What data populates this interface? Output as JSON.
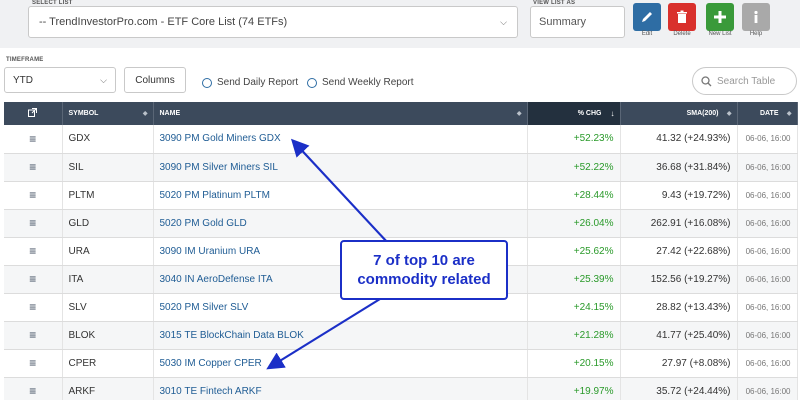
{
  "header": {
    "select_list_label": "SELECT LIST",
    "select_list_value": "-- TrendInvestorPro.com - ETF Core List (74 ETFs)",
    "view_list_as_label": "VIEW LIST AS",
    "view_list_as_value": "Summary",
    "tools": [
      {
        "label": "Edit",
        "icon": "pencil-icon",
        "color": "#2e6da4"
      },
      {
        "label": "Delete",
        "icon": "trash-icon",
        "color": "#d9302c"
      },
      {
        "label": "New List",
        "icon": "plus-icon",
        "color": "#3a9a3a"
      },
      {
        "label": "Help",
        "icon": "info-icon",
        "color": "#a9a9a9"
      }
    ]
  },
  "controls": {
    "timeframe_label": "TIMEFRAME",
    "timeframe_value": "YTD",
    "columns_label": "Columns",
    "send_daily": "Send Daily Report",
    "send_weekly": "Send Weekly Report",
    "search_placeholder": "Search Table"
  },
  "table": {
    "headers": [
      "SYMBOL",
      "NAME",
      "% CHG",
      "SMA(200)",
      "DATE"
    ],
    "rows": [
      {
        "symbol": "GDX",
        "name": "3090 PM Gold Miners GDX",
        "pct": "+52.23%",
        "sma": "41.32 (+24.93%)",
        "date": "06-06, 16:00"
      },
      {
        "symbol": "SIL",
        "name": "3090 PM Silver Miners SIL",
        "pct": "+52.22%",
        "sma": "36.68 (+31.84%)",
        "date": "06-06, 16:00"
      },
      {
        "symbol": "PLTM",
        "name": "5020 PM Platinum PLTM",
        "pct": "+28.44%",
        "sma": "9.43 (+19.72%)",
        "date": "06-06, 16:00"
      },
      {
        "symbol": "GLD",
        "name": "5020 PM Gold GLD",
        "pct": "+26.04%",
        "sma": "262.91 (+16.08%)",
        "date": "06-06, 16:00"
      },
      {
        "symbol": "URA",
        "name": "3090 IM Uranium URA",
        "pct": "+25.62%",
        "sma": "27.42 (+22.68%)",
        "date": "06-06, 16:00"
      },
      {
        "symbol": "ITA",
        "name": "3040 IN AeroDefense ITA",
        "pct": "+25.39%",
        "sma": "152.56 (+19.27%)",
        "date": "06-06, 16:00"
      },
      {
        "symbol": "SLV",
        "name": "5020 PM Silver SLV",
        "pct": "+24.15%",
        "sma": "28.82 (+13.43%)",
        "date": "06-06, 16:00"
      },
      {
        "symbol": "BLOK",
        "name": "3015 TE BlockChain Data BLOK",
        "pct": "+21.28%",
        "sma": "41.77 (+25.40%)",
        "date": "06-06, 16:00"
      },
      {
        "symbol": "CPER",
        "name": "5030 IM Copper CPER",
        "pct": "+20.15%",
        "sma": "27.97 (+8.08%)",
        "date": "06-06, 16:00"
      },
      {
        "symbol": "ARKF",
        "name": "3010 TE Fintech ARKF",
        "pct": "+19.97%",
        "sma": "35.72 (+24.44%)",
        "date": "06-06, 16:00"
      }
    ]
  },
  "annotation": {
    "line1": "7 of top 10 are",
    "line2": "commodity related",
    "color": "#1b2fc7"
  }
}
